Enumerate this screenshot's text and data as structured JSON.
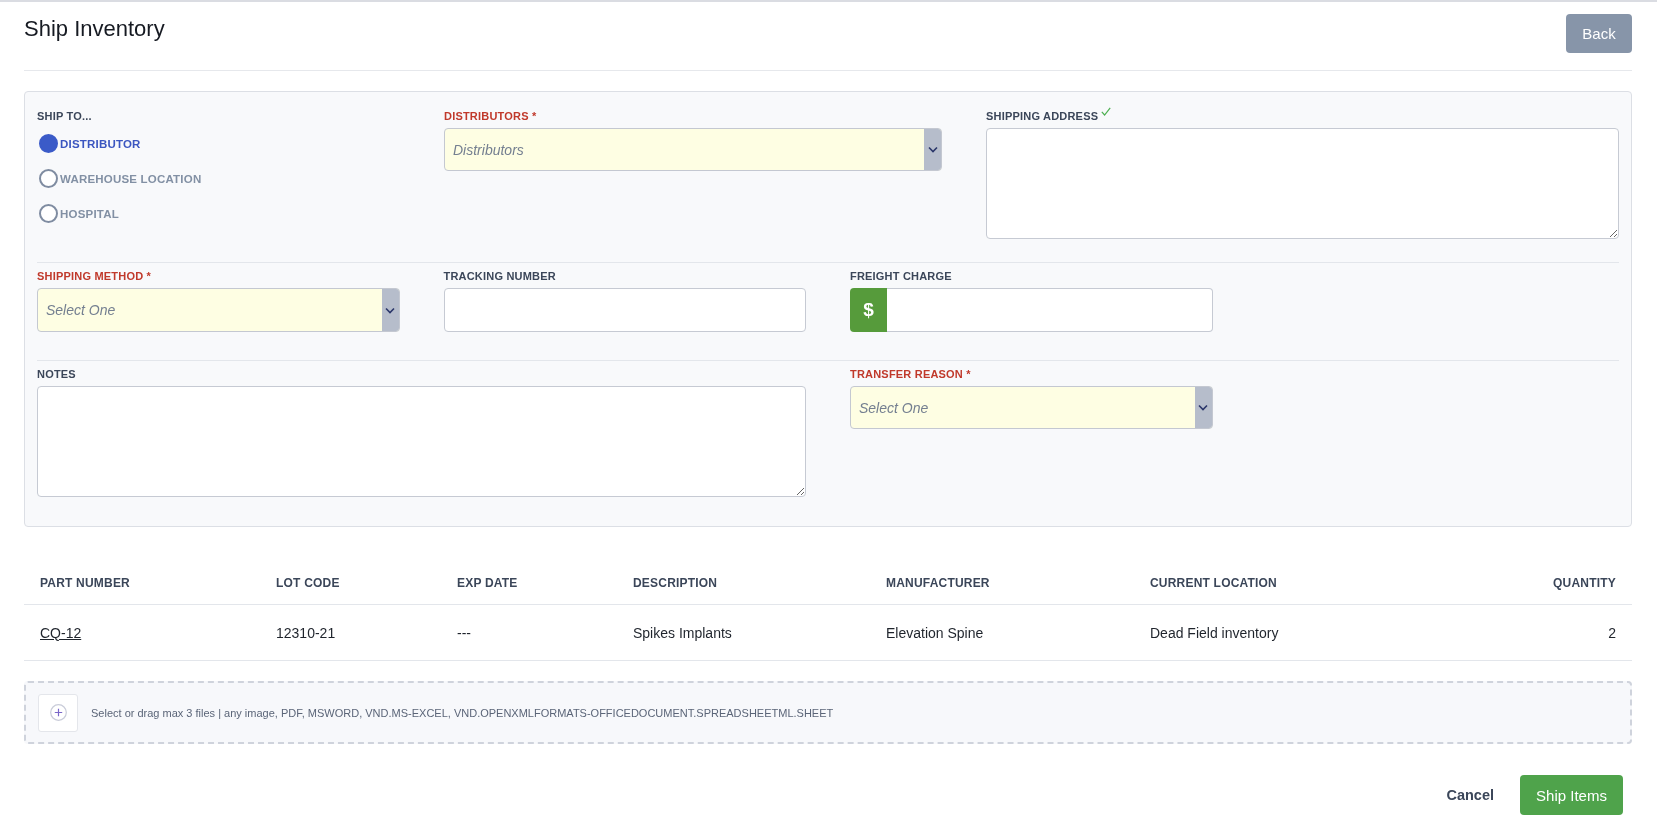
{
  "header": {
    "title": "Ship Inventory",
    "back_button": "Back"
  },
  "form": {
    "ship_to": {
      "label": "SHIP TO...",
      "required": false,
      "options": [
        {
          "label": "DISTRIBUTOR",
          "selected": true
        },
        {
          "label": "WAREHOUSE LOCATION",
          "selected": false
        },
        {
          "label": "HOSPITAL",
          "selected": false
        }
      ]
    },
    "distributors": {
      "label": "DISTRIBUTORS *",
      "required": true,
      "placeholder": "Distributors"
    },
    "shipping_address": {
      "label": "SHIPPING ADDRESS",
      "required": false,
      "valid": true
    },
    "shipping_method": {
      "label": "SHIPPING METHOD *",
      "required": true,
      "placeholder": "Select One"
    },
    "tracking_number": {
      "label": "TRACKING NUMBER",
      "required": false
    },
    "freight_charge": {
      "label": "FREIGHT CHARGE",
      "required": false,
      "prefix": "$"
    },
    "notes": {
      "label": "NOTES",
      "required": false
    },
    "transfer_reason": {
      "label": "TRANSFER REASON *",
      "required": true,
      "placeholder": "Select One"
    }
  },
  "table": {
    "columns": [
      "PART NUMBER",
      "LOT CODE",
      "EXP DATE",
      "DESCRIPTION",
      "MANUFACTURER",
      "CURRENT LOCATION",
      "QUANTITY"
    ],
    "rows": [
      {
        "cells": [
          "CQ-12",
          "12310-21",
          "---",
          "Spikes Implants",
          "Elevation Spine",
          "Dead Field inventory",
          "2"
        ]
      }
    ]
  },
  "upload": {
    "hint": "Select or drag max 3 files | any image, PDF, MSWORD, VND.MS-EXCEL, VND.OPENXMLFORMATS-OFFICEDOCUMENT.SPREADSHEETML.SHEET"
  },
  "actions": {
    "cancel": "Cancel",
    "submit": "Ship Items"
  }
}
